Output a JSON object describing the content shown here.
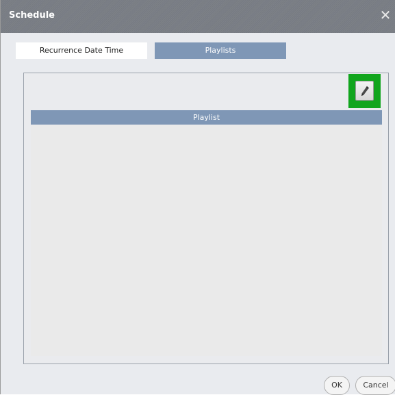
{
  "dialog": {
    "title": "Schedule",
    "close_icon": "close-icon",
    "close_glyph": "✕"
  },
  "tabs": [
    {
      "label": "Recurrence Date Time",
      "active": false
    },
    {
      "label": "Playlists",
      "active": true
    }
  ],
  "toolbar": {
    "edit_icon": "pencil-icon"
  },
  "table": {
    "columns": [
      "Playlist"
    ],
    "rows": []
  },
  "footer": {
    "ok_label": "OK",
    "cancel_label": "Cancel"
  },
  "colors": {
    "accent": "#7f97b6",
    "highlight": "#11a51d",
    "titlebar": "#7b7f86"
  }
}
